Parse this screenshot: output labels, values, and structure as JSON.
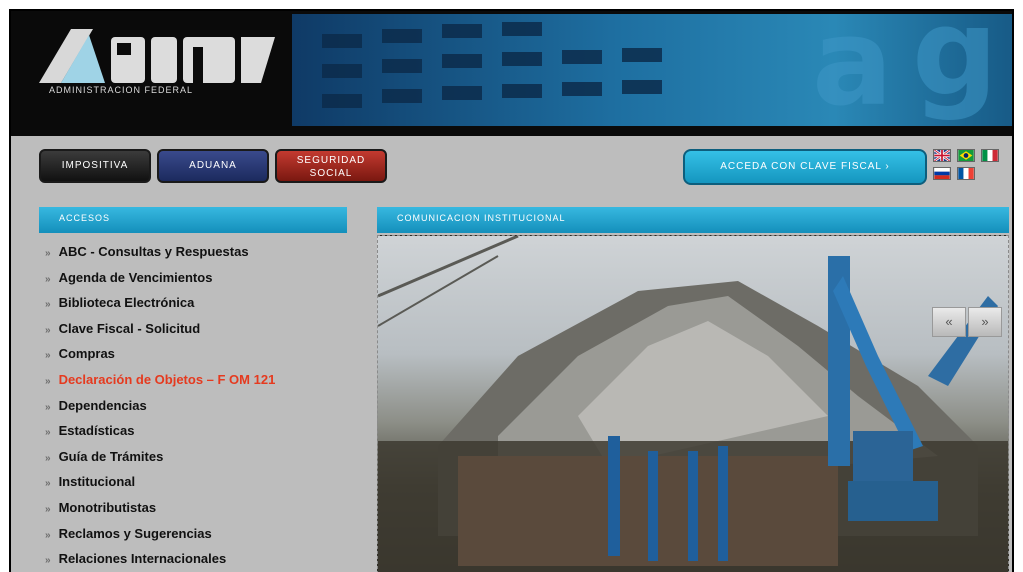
{
  "header": {
    "logo_text": "AFIP",
    "logo_subtitle": "ADMINISTRACION FEDERAL"
  },
  "nav": {
    "impositiva": "IMPOSITIVA",
    "aduana": "ADUANA",
    "seguridad": "SEGURIDAD SOCIAL"
  },
  "clave_button": "ACCEDA CON CLAVE FISCAL ›",
  "flags": [
    "uk-flag-icon",
    "brazil-flag-icon",
    "italy-flag-icon",
    "russia-flag-icon",
    "france-flag-icon"
  ],
  "sidebar": {
    "title": "ACCESOS",
    "items": [
      {
        "label": "ABC - Consultas y Respuestas",
        "highlight": false
      },
      {
        "label": "Agenda de Vencimientos",
        "highlight": false
      },
      {
        "label": "Biblioteca Electrónica",
        "highlight": false
      },
      {
        "label": "Clave Fiscal - Solicitud",
        "highlight": false
      },
      {
        "label": "Compras",
        "highlight": false
      },
      {
        "label": "Declaración de Objetos – F OM 121",
        "highlight": true
      },
      {
        "label": "Dependencias",
        "highlight": false
      },
      {
        "label": "Estadísticas",
        "highlight": false
      },
      {
        "label": "Guía de Trámites",
        "highlight": false
      },
      {
        "label": "Institucional",
        "highlight": false
      },
      {
        "label": "Monotributistas",
        "highlight": false
      },
      {
        "label": "Reclamos y Sugerencias",
        "highlight": false
      },
      {
        "label": "Relaciones Internacionales",
        "highlight": false
      }
    ]
  },
  "main": {
    "title": "COMUNICACION INSTITUCIONAL"
  },
  "slideshow": {
    "prev": "«",
    "next": "»"
  }
}
